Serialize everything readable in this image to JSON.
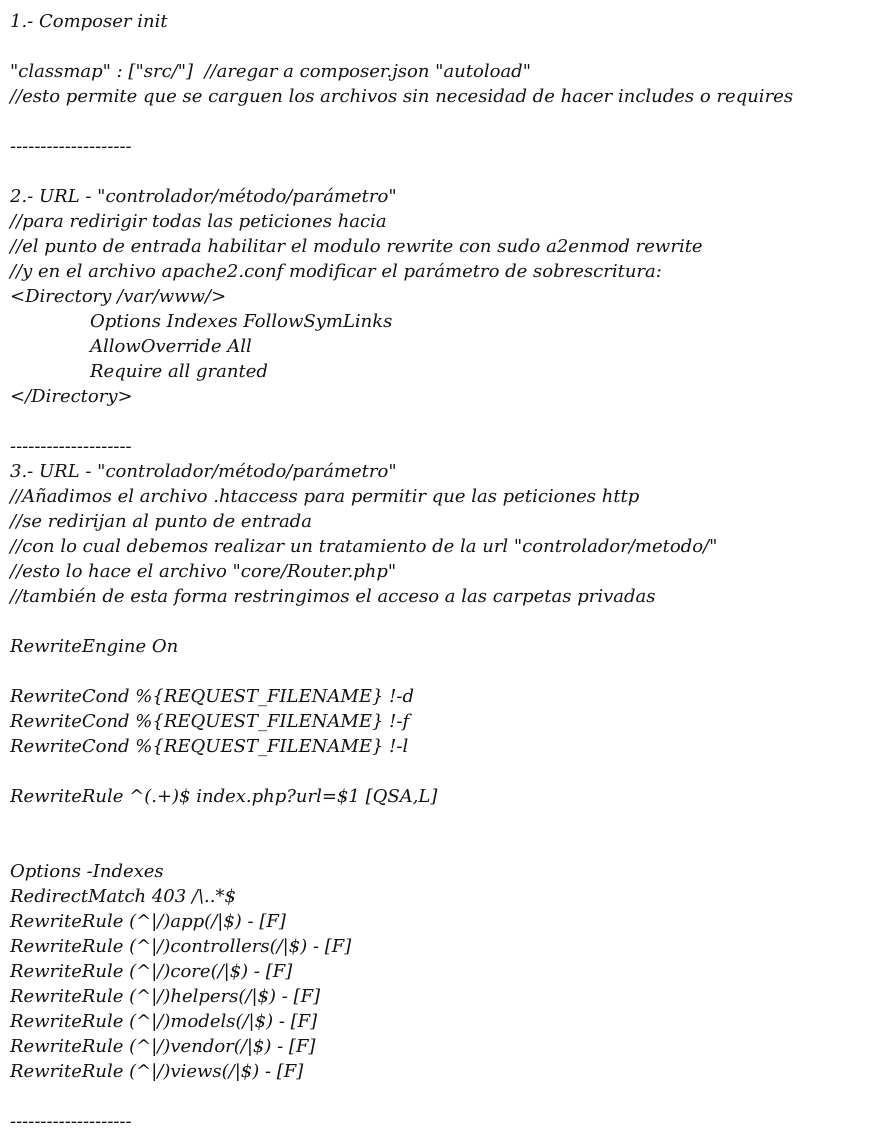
{
  "lines": [
    "1.- Composer init",
    "",
    "\"classmap\" : [\"src/\"]  //aregar a composer.json \"autoload\"",
    "//esto permite que se carguen los archivos sin necesidad de hacer includes o requires",
    "",
    "--------------------",
    "",
    "2.- URL - \"controlador/método/parámetro\"",
    "//para redirigir todas las peticiones hacia",
    "//el punto de entrada habilitar el modulo rewrite con sudo a2enmod rewrite",
    "//y en el archivo apache2.conf modificar el parámetro de sobrescritura:",
    "<Directory /var/www/>",
    "Options Indexes FollowSymLinks",
    "AllowOverride All",
    "Require all granted",
    "</Directory>",
    "",
    "--------------------",
    "3.- URL - \"controlador/método/parámetro\"",
    "//Añadimos el archivo .htaccess para permitir que las peticiones http",
    "//se redirijan al punto de entrada",
    "//con lo cual debemos realizar un tratamiento de la url \"controlador/metodo/\"",
    "//esto lo hace el archivo \"core/Router.php\"",
    "//también de esta forma restringimos el acceso a las carpetas privadas",
    "",
    "RewriteEngine On",
    "",
    "RewriteCond %{REQUEST_FILENAME} !-d",
    "RewriteCond %{REQUEST_FILENAME} !-f",
    "RewriteCond %{REQUEST_FILENAME} !-l",
    "",
    "RewriteRule ^(.+)$ index.php?url=$1 [QSA,L]",
    "",
    "",
    "Options -Indexes",
    "RedirectMatch 403 /\\..*$",
    "RewriteRule (^|/)app(/|$) - [F]",
    "RewriteRule (^|/)controllers(/|$) - [F]",
    "RewriteRule (^|/)core(/|$) - [F]",
    "RewriteRule (^|/)helpers(/|$) - [F]",
    "RewriteRule (^|/)models(/|$) - [F]",
    "RewriteRule (^|/)vendor(/|$) - [F]",
    "RewriteRule (^|/)views(/|$) - [F]",
    "",
    "--------------------"
  ]
}
